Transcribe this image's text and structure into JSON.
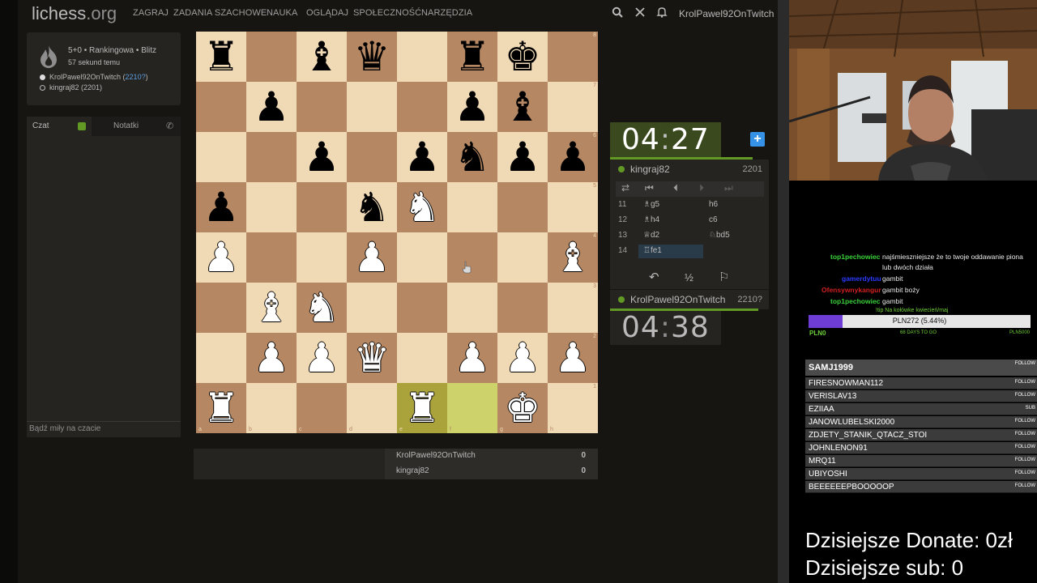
{
  "app": {
    "logo_main": "lichess",
    "logo_tld": ".org",
    "nav": [
      "ZAGRAJ",
      "ZADANIA SZACHOWE",
      "NAUKA",
      "OGLĄDAJ",
      "SPOŁECZNOŚĆ",
      "NARZĘDZIA"
    ],
    "username": "KrolPawel92OnTwitch"
  },
  "game_info": {
    "title": "5+0 • Rankingowa • Blitz",
    "time_ago": "57 sekund temu",
    "white_player": "KrolPawel92OnTwitch",
    "white_rating": "2210?",
    "black_player": "kingraj82 (2201)"
  },
  "chat": {
    "tab_chat": "Czat",
    "tab_notes": "Notatki",
    "input_placeholder": "Bądź miły na czacie"
  },
  "board": {
    "ranks": [
      [
        [
          "r",
          "b"
        ],
        null,
        [
          "b",
          "b"
        ],
        [
          "q",
          "b"
        ],
        null,
        [
          "r",
          "b"
        ],
        [
          "k",
          "b"
        ],
        null
      ],
      [
        null,
        [
          "p",
          "b"
        ],
        null,
        null,
        null,
        [
          "p",
          "b"
        ],
        [
          "b",
          "b"
        ],
        null
      ],
      [
        null,
        null,
        [
          "p",
          "b"
        ],
        null,
        [
          "p",
          "b"
        ],
        [
          "n",
          "b"
        ],
        [
          "p",
          "b"
        ],
        [
          "p",
          "b"
        ]
      ],
      [
        [
          "p",
          "b"
        ],
        null,
        null,
        [
          "n",
          "b"
        ],
        [
          "n",
          "w"
        ],
        null,
        null,
        null
      ],
      [
        [
          "p",
          "w"
        ],
        null,
        null,
        [
          "p",
          "w"
        ],
        null,
        null,
        null,
        [
          "b",
          "w"
        ]
      ],
      [
        null,
        [
          "b",
          "w"
        ],
        [
          "n",
          "w"
        ],
        null,
        null,
        null,
        null,
        null
      ],
      [
        null,
        [
          "p",
          "w"
        ],
        [
          "p",
          "w"
        ],
        [
          "q",
          "w"
        ],
        null,
        [
          "p",
          "w"
        ],
        [
          "p",
          "w"
        ],
        [
          "p",
          "w"
        ]
      ],
      [
        [
          "r",
          "w"
        ],
        null,
        null,
        null,
        [
          "r",
          "w"
        ],
        null,
        [
          "k",
          "w"
        ],
        null
      ]
    ],
    "highlights": [
      "e1",
      "f1"
    ],
    "rank_labels": [
      "8",
      "7",
      "6",
      "5",
      "4",
      "3",
      "2",
      "1"
    ],
    "file_labels": [
      "a",
      "b",
      "c",
      "d",
      "e",
      "f",
      "g",
      "h"
    ]
  },
  "scores": [
    {
      "name": "KrolPawel92OnTwitch",
      "score": "0"
    },
    {
      "name": "kingraj82",
      "score": "0"
    }
  ],
  "clocks": {
    "top_mm": "04",
    "top_ss": "27",
    "bottom_mm": "04",
    "bottom_ss": "38",
    "sep": ":"
  },
  "opponent": {
    "name": "kingraj82",
    "rating": "2201"
  },
  "me": {
    "name": "KrolPawel92OnTwitch",
    "rating": "2210?"
  },
  "moves": [
    {
      "num": "11",
      "white": "♗g5",
      "black": "h6"
    },
    {
      "num": "12",
      "white": "♗h4",
      "black": "c6"
    },
    {
      "num": "13",
      "white": "♕d2",
      "black": "♘bd5"
    },
    {
      "num": "14",
      "white": "♖fe1",
      "black": ""
    }
  ],
  "stream": {
    "chat": [
      {
        "user": "top1pechowiec",
        "color": "#3ad13a",
        "text": "najśmieszniejsze że to twoje oddawanie piona",
        "text2": "lub dwóch działa"
      },
      {
        "user": "gamerdytuu",
        "color": "#2b3bff",
        "text": "gambit",
        "text2": ""
      },
      {
        "user": "Ofensywnykangur",
        "color": "#d12020",
        "text": "gambit boży",
        "text2": ""
      },
      {
        "user": "top1pechowiec",
        "color": "#3ad13a",
        "text": "gambit",
        "text2": ""
      }
    ],
    "tip_text": "!tip Na kołówke kwiecień/maj",
    "donation": {
      "label": "PLN272 (5.44%)",
      "progress": 0.0544,
      "min": "PLN0",
      "days_left": "68 DAYS TO GO",
      "max": "PLN5000"
    },
    "events": [
      {
        "name": "SAMJ1999",
        "type": "FOLLOW"
      },
      {
        "name": "FIRESNOWMAN112",
        "type": "FOLLOW"
      },
      {
        "name": "VERISLAV13",
        "type": "FOLLOW"
      },
      {
        "name": "EZIIAA",
        "type": "SUB"
      },
      {
        "name": "JANOWLUBELSKI2000",
        "type": "FOLLOW"
      },
      {
        "name": "ZDJETY_STANIK_QTACZ_STOI",
        "type": "FOLLOW"
      },
      {
        "name": "JOHNLENON91",
        "type": "FOLLOW"
      },
      {
        "name": "MRQ11",
        "type": "FOLLOW"
      },
      {
        "name": "UBIYOSHI",
        "type": "FOLLOW"
      },
      {
        "name": "BEEEEEEPBOOOOOP",
        "type": "FOLLOW"
      }
    ],
    "donate_today": "Dzisiejsze Donate: 0zł",
    "sub_today": "Dzisiejsze sub: 0"
  },
  "colors": {
    "board_light": "#f0d9b5",
    "board_dark": "#b58863",
    "accent_green": "#629924",
    "accent_blue": "#3692e7"
  },
  "icons": {
    "search": "search-icon",
    "swords": "swords-icon",
    "bell": "bell-icon"
  }
}
